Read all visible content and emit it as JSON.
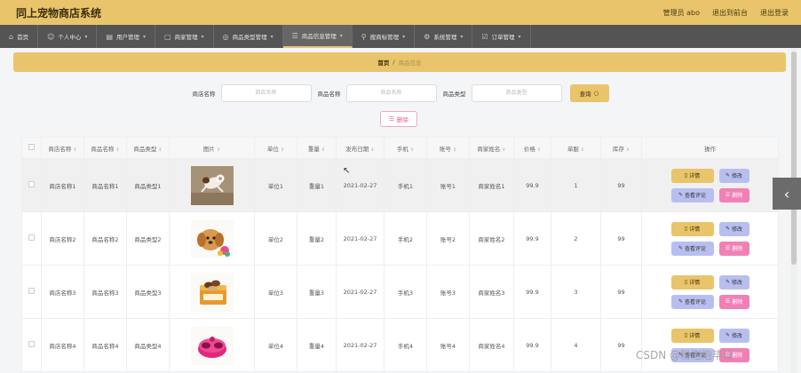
{
  "app": {
    "title": "同上宠物商店系统",
    "admin": "管理员 abo",
    "back_link": "退出到前台",
    "logout": "退出登录"
  },
  "nav": [
    {
      "label": "首页",
      "icon": "home-icon",
      "glyph": "⌂"
    },
    {
      "label": "个人中心",
      "icon": "user-icon",
      "glyph": "☺"
    },
    {
      "label": "用户管理",
      "icon": "users-icon",
      "glyph": "▤"
    },
    {
      "label": "商家管理",
      "icon": "store-icon",
      "glyph": "▢"
    },
    {
      "label": "商品类型管理",
      "icon": "category-icon",
      "glyph": "◎"
    },
    {
      "label": "商品信息管理",
      "icon": "goods-icon",
      "glyph": "☰",
      "active": true
    },
    {
      "label": "搜商标管理",
      "icon": "location-icon",
      "glyph": "⚲"
    },
    {
      "label": "系统管理",
      "icon": "settings-icon",
      "glyph": "⚙"
    },
    {
      "label": "订单管理",
      "icon": "order-icon",
      "glyph": "☑"
    }
  ],
  "breadcrumb": {
    "home": "首页",
    "separator": "/",
    "current": "商品信息"
  },
  "search": {
    "fields": [
      {
        "label": "商店名称",
        "placeholder": "商店名称"
      },
      {
        "label": "商品名称",
        "placeholder": "商品名称"
      },
      {
        "label": "商品类型",
        "placeholder": "商品类型"
      }
    ],
    "button": "查询",
    "button_icon": "○"
  },
  "delete_button": "删除",
  "table": {
    "columns": [
      "商店名称",
      "商品名称",
      "商品类型",
      "图片",
      "单位",
      "重量",
      "发布日期",
      "手机",
      "账号",
      "商家姓名",
      "价格",
      "单服",
      "库存",
      "操作"
    ],
    "rows": [
      {
        "store": "商店名称1",
        "product": "商品名称1",
        "type": "商品类型1",
        "image": "dog-jumping",
        "unit": "单位1",
        "weight": "重量1",
        "date": "2021-02-27",
        "phone": "手机1",
        "account": "账号1",
        "merchant": "商家姓名1",
        "price": "99.9",
        "single": "1",
        "stock": "99"
      },
      {
        "store": "商店名称2",
        "product": "商品名称2",
        "type": "商品类型2",
        "image": "puppy-toys",
        "unit": "单位2",
        "weight": "重量2",
        "date": "2021-02-27",
        "phone": "手机2",
        "account": "账号2",
        "merchant": "商家姓名2",
        "price": "99.9",
        "single": "2",
        "stock": "99"
      },
      {
        "store": "商店名称3",
        "product": "商品名称3",
        "type": "商品类型3",
        "image": "pet-snacks-box",
        "unit": "单位3",
        "weight": "重量3",
        "date": "2021-02-27",
        "phone": "手机3",
        "account": "账号3",
        "merchant": "商家姓名3",
        "price": "99.9",
        "single": "3",
        "stock": "99"
      },
      {
        "store": "商店名称4",
        "product": "商品名称4",
        "type": "商品类型4",
        "image": "pink-pet-bowl",
        "unit": "单位4",
        "weight": "重量4",
        "date": "2021-02-27",
        "phone": "手机4",
        "account": "账号4",
        "merchant": "商家姓名4",
        "price": "99.9",
        "single": "4",
        "stock": "99"
      }
    ],
    "actions": {
      "detail": "详情",
      "edit": "修改",
      "review": "查看评论",
      "delete": "删除"
    }
  },
  "watermark": "CSDN @粉泡泡毕设",
  "colors": {
    "accent": "#e9c46a",
    "nav_bg": "#545454",
    "edit": "#b8bff0",
    "delete": "#f27fb6"
  }
}
